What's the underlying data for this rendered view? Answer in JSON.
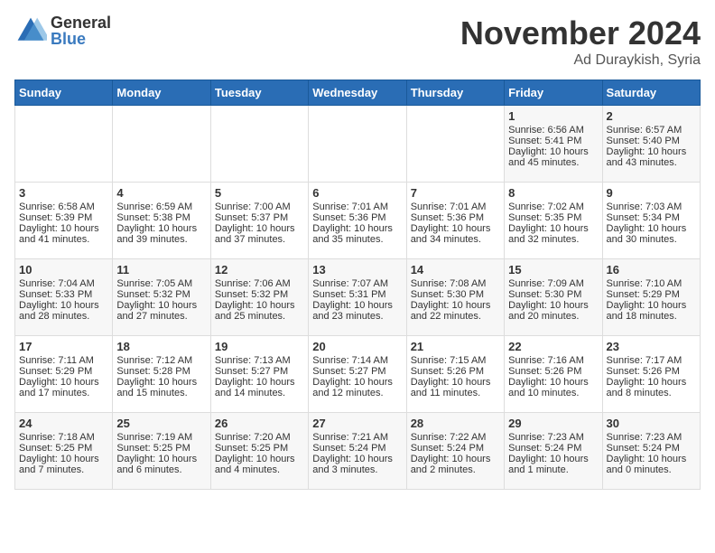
{
  "header": {
    "logo_general": "General",
    "logo_blue": "Blue",
    "month": "November 2024",
    "location": "Ad Duraykish, Syria"
  },
  "days_of_week": [
    "Sunday",
    "Monday",
    "Tuesday",
    "Wednesday",
    "Thursday",
    "Friday",
    "Saturday"
  ],
  "weeks": [
    [
      {
        "day": "",
        "info": ""
      },
      {
        "day": "",
        "info": ""
      },
      {
        "day": "",
        "info": ""
      },
      {
        "day": "",
        "info": ""
      },
      {
        "day": "",
        "info": ""
      },
      {
        "day": "1",
        "info": "Sunrise: 6:56 AM\nSunset: 5:41 PM\nDaylight: 10 hours\nand 45 minutes."
      },
      {
        "day": "2",
        "info": "Sunrise: 6:57 AM\nSunset: 5:40 PM\nDaylight: 10 hours\nand 43 minutes."
      }
    ],
    [
      {
        "day": "3",
        "info": "Sunrise: 6:58 AM\nSunset: 5:39 PM\nDaylight: 10 hours\nand 41 minutes."
      },
      {
        "day": "4",
        "info": "Sunrise: 6:59 AM\nSunset: 5:38 PM\nDaylight: 10 hours\nand 39 minutes."
      },
      {
        "day": "5",
        "info": "Sunrise: 7:00 AM\nSunset: 5:37 PM\nDaylight: 10 hours\nand 37 minutes."
      },
      {
        "day": "6",
        "info": "Sunrise: 7:01 AM\nSunset: 5:36 PM\nDaylight: 10 hours\nand 35 minutes."
      },
      {
        "day": "7",
        "info": "Sunrise: 7:01 AM\nSunset: 5:36 PM\nDaylight: 10 hours\nand 34 minutes."
      },
      {
        "day": "8",
        "info": "Sunrise: 7:02 AM\nSunset: 5:35 PM\nDaylight: 10 hours\nand 32 minutes."
      },
      {
        "day": "9",
        "info": "Sunrise: 7:03 AM\nSunset: 5:34 PM\nDaylight: 10 hours\nand 30 minutes."
      }
    ],
    [
      {
        "day": "10",
        "info": "Sunrise: 7:04 AM\nSunset: 5:33 PM\nDaylight: 10 hours\nand 28 minutes."
      },
      {
        "day": "11",
        "info": "Sunrise: 7:05 AM\nSunset: 5:32 PM\nDaylight: 10 hours\nand 27 minutes."
      },
      {
        "day": "12",
        "info": "Sunrise: 7:06 AM\nSunset: 5:32 PM\nDaylight: 10 hours\nand 25 minutes."
      },
      {
        "day": "13",
        "info": "Sunrise: 7:07 AM\nSunset: 5:31 PM\nDaylight: 10 hours\nand 23 minutes."
      },
      {
        "day": "14",
        "info": "Sunrise: 7:08 AM\nSunset: 5:30 PM\nDaylight: 10 hours\nand 22 minutes."
      },
      {
        "day": "15",
        "info": "Sunrise: 7:09 AM\nSunset: 5:30 PM\nDaylight: 10 hours\nand 20 minutes."
      },
      {
        "day": "16",
        "info": "Sunrise: 7:10 AM\nSunset: 5:29 PM\nDaylight: 10 hours\nand 18 minutes."
      }
    ],
    [
      {
        "day": "17",
        "info": "Sunrise: 7:11 AM\nSunset: 5:29 PM\nDaylight: 10 hours\nand 17 minutes."
      },
      {
        "day": "18",
        "info": "Sunrise: 7:12 AM\nSunset: 5:28 PM\nDaylight: 10 hours\nand 15 minutes."
      },
      {
        "day": "19",
        "info": "Sunrise: 7:13 AM\nSunset: 5:27 PM\nDaylight: 10 hours\nand 14 minutes."
      },
      {
        "day": "20",
        "info": "Sunrise: 7:14 AM\nSunset: 5:27 PM\nDaylight: 10 hours\nand 12 minutes."
      },
      {
        "day": "21",
        "info": "Sunrise: 7:15 AM\nSunset: 5:26 PM\nDaylight: 10 hours\nand 11 minutes."
      },
      {
        "day": "22",
        "info": "Sunrise: 7:16 AM\nSunset: 5:26 PM\nDaylight: 10 hours\nand 10 minutes."
      },
      {
        "day": "23",
        "info": "Sunrise: 7:17 AM\nSunset: 5:26 PM\nDaylight: 10 hours\nand 8 minutes."
      }
    ],
    [
      {
        "day": "24",
        "info": "Sunrise: 7:18 AM\nSunset: 5:25 PM\nDaylight: 10 hours\nand 7 minutes."
      },
      {
        "day": "25",
        "info": "Sunrise: 7:19 AM\nSunset: 5:25 PM\nDaylight: 10 hours\nand 6 minutes."
      },
      {
        "day": "26",
        "info": "Sunrise: 7:20 AM\nSunset: 5:25 PM\nDaylight: 10 hours\nand 4 minutes."
      },
      {
        "day": "27",
        "info": "Sunrise: 7:21 AM\nSunset: 5:24 PM\nDaylight: 10 hours\nand 3 minutes."
      },
      {
        "day": "28",
        "info": "Sunrise: 7:22 AM\nSunset: 5:24 PM\nDaylight: 10 hours\nand 2 minutes."
      },
      {
        "day": "29",
        "info": "Sunrise: 7:23 AM\nSunset: 5:24 PM\nDaylight: 10 hours\nand 1 minute."
      },
      {
        "day": "30",
        "info": "Sunrise: 7:23 AM\nSunset: 5:24 PM\nDaylight: 10 hours\nand 0 minutes."
      }
    ]
  ]
}
